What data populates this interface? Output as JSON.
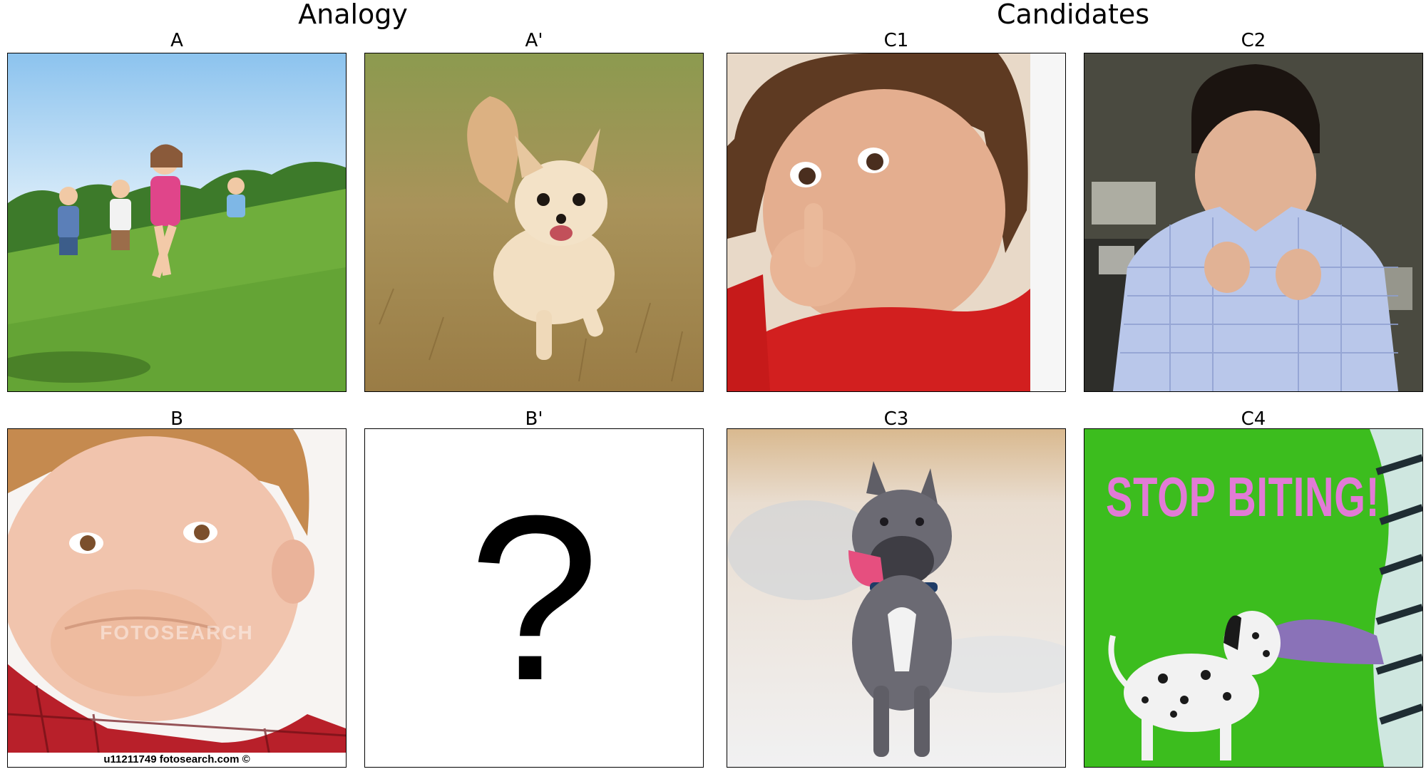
{
  "titles": {
    "analogy": "Analogy",
    "candidates": "Candidates"
  },
  "panels": {
    "A": {
      "label": "A",
      "content": "children-running-on-grass-image"
    },
    "A_prime": {
      "label": "A'",
      "content": "small-dog-running-on-grass-image"
    },
    "B": {
      "label": "B",
      "content": "boy-biting-hand-image",
      "watermark": "FOTOSEARCH",
      "caption": "u11211749 fotosearch.com ©"
    },
    "B_prime": {
      "label": "B'",
      "content": "question-mark",
      "symbol": "?"
    },
    "C1": {
      "label": "C1",
      "content": "toddler-hand-in-mouth-image"
    },
    "C2": {
      "label": "C2",
      "content": "boy-biting-shirt-image"
    },
    "C3": {
      "label": "C3",
      "content": "dog-running-tongue-out-image"
    },
    "C4": {
      "label": "C4",
      "content": "dalmatian-biting-hand-image",
      "text": "STOP BITING!"
    }
  },
  "colors": {
    "grass": "#6fae3c",
    "sky": "#cfe6f7",
    "dry_grass": "#b89a5c",
    "green_screen": "#3cbd1e",
    "stop_text": "#e27ad6",
    "red_shirt": "#d21f1f",
    "blue_shirt": "#b9c7ea"
  }
}
